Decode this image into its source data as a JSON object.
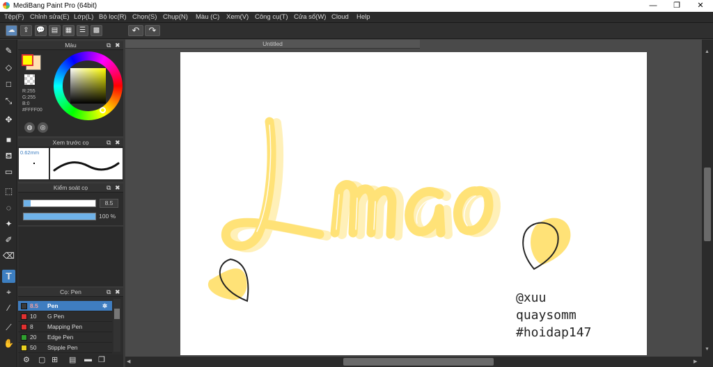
{
  "window": {
    "title": "MediBang Paint Pro (64bit)",
    "minimize": "—",
    "maximize": "❐",
    "close": "✕"
  },
  "menu": [
    "Tệp(F)",
    "Chỉnh sửa(E)",
    "Lớp(L)",
    "Bộ lọc(R)",
    "Chọn(S)",
    "Chụp(N)",
    "Màu (C)",
    "Xem(V)",
    "Công cụ(T)",
    "Cửa sổ(W)",
    "Cloud",
    "Help"
  ],
  "toolbar": {
    "undo": "↶",
    "redo": "↷"
  },
  "color_panel": {
    "title": "Màu",
    "r": "R:255",
    "g": "G:255",
    "b": "B:0",
    "hex": "#FFFF00",
    "fg_color": "#ffff00",
    "bg_color": "#ffe0b0"
  },
  "brush_preview": {
    "title": "Xem trước cọ",
    "size": "0.62mm"
  },
  "brush_control": {
    "title": "Kiểm soát cọ",
    "size_value": "8.5",
    "size_fraction": 0.1,
    "opacity_value": "100 %",
    "opacity_fraction": 1.0
  },
  "brush_panel": {
    "title": "Cọ: Pen",
    "items": [
      {
        "size": "8.5",
        "name": "Pen",
        "color": "#3a3a3a",
        "selected": true
      },
      {
        "size": "10",
        "name": "G Pen",
        "color": "#e03030"
      },
      {
        "size": "8",
        "name": "Mapping Pen",
        "color": "#e03030"
      },
      {
        "size": "20",
        "name": "Edge Pen",
        "color": "#30a030"
      },
      {
        "size": "50",
        "name": "Stipple Pen",
        "color": "#e8d020"
      }
    ]
  },
  "document": {
    "tab_title": "Untitled"
  },
  "canvas_art": {
    "lettering": "Lmao",
    "signature": [
      "@xuu",
      "quaysomm",
      "#hoidap147"
    ],
    "accent_color": "#ffe066"
  }
}
